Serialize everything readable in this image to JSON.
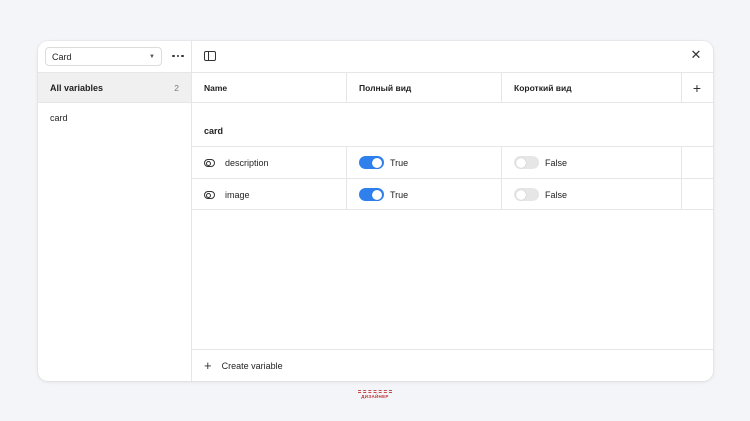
{
  "sidebar": {
    "collection_select": "Card",
    "header_title": "All variables",
    "header_count": "2",
    "groups": [
      "card"
    ]
  },
  "table": {
    "columns": [
      "Name",
      "Полный вид",
      "Короткий вид"
    ],
    "group_label": "card",
    "rows": [
      {
        "name": "description",
        "full": {
          "on": true,
          "label": "True"
        },
        "short": {
          "on": false,
          "label": "False"
        }
      },
      {
        "name": "image",
        "full": {
          "on": true,
          "label": "True"
        },
        "short": {
          "on": false,
          "label": "False"
        }
      }
    ]
  },
  "footer": {
    "create_label": "Create variable"
  },
  "colors": {
    "toggle_on": "#2f80ed",
    "toggle_off": "#e6e6e6"
  },
  "watermark": "ДИЗАЙНЕР"
}
